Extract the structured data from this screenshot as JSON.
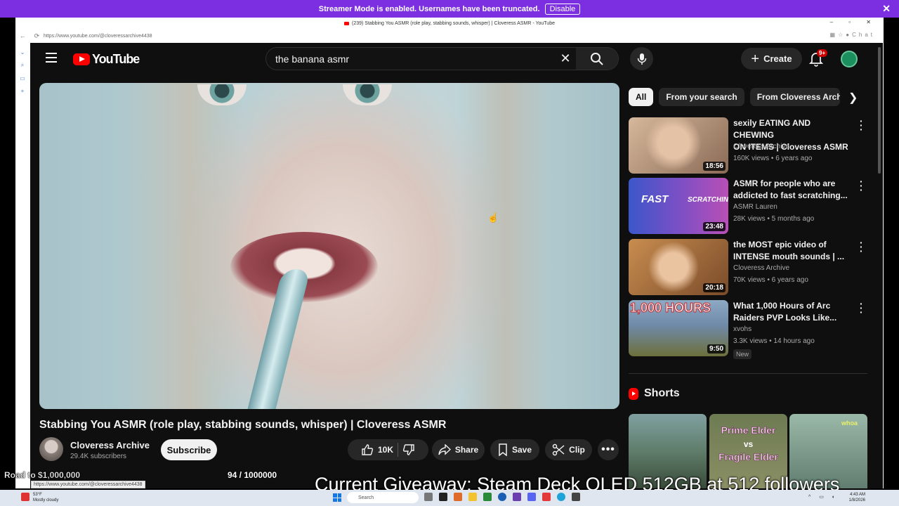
{
  "banner": {
    "message": "Streamer Mode is enabled. Usernames have been truncated.",
    "disable_label": "Disable",
    "close": "✕"
  },
  "browser": {
    "tab_title": "(239) Stabbing You ASMR (role play, stabbing sounds, whisper) | Cloveress ASMR - YouTube",
    "url": "https://www.youtube.com/@cloveressarchive4438",
    "chat_label": "Chat",
    "window_controls": "– ▫ ✕"
  },
  "masthead": {
    "logo_text": "YouTube",
    "search_query": "the banana asmr",
    "create_label": "Create",
    "notif_badge": "9+"
  },
  "video": {
    "title": "Stabbing You ASMR (role play, stabbing sounds, whisper) | Cloveress ASMR",
    "channel": "Cloveress Archive",
    "subscribers": "29.4K subscribers",
    "subscribe_label": "Subscribe",
    "likes": "10K",
    "share_label": "Share",
    "save_label": "Save",
    "clip_label": "Clip"
  },
  "chips": [
    "All",
    "From your search",
    "From Cloveress Archive"
  ],
  "recommendations": [
    {
      "title_l1": "sexily EATING AND CHEWING",
      "title_l2": "ON ITEMS | Cloveress ASMR",
      "channel": "Cloveress Archive",
      "meta": "160K views • 6 years ago",
      "duration": "18:56",
      "colors": [
        "#d6b89c",
        "#8a6a55"
      ]
    },
    {
      "title_l1": "ASMR for people who are",
      "title_l2": "addicted to fast scratching...",
      "channel": "ASMR Lauren",
      "meta": "28K views • 5 months ago",
      "duration": "23:48",
      "overlay_a": "FAST",
      "overlay_b": "SCRATCHING",
      "colors": [
        "#3b57c9",
        "#b84fb6"
      ]
    },
    {
      "title_l1": "the MOST epic video of",
      "title_l2": "INTENSE mouth sounds | ...",
      "channel": "Cloveress Archive",
      "meta": "70K views • 6 years ago",
      "duration": "20:18",
      "colors": [
        "#c88d4f",
        "#7a4b2a"
      ]
    },
    {
      "title_l1": "What 1,000 Hours of Arc",
      "title_l2": "Raiders PVP Looks Like...",
      "channel": "xvohs",
      "meta": "3.3K views • 14 hours ago",
      "duration": "9:50",
      "badge": "New",
      "overlay_a": "1,000 HOURS",
      "colors": [
        "#6f8aa8",
        "#6d6f3a"
      ]
    }
  ],
  "shorts": {
    "heading": "Shorts",
    "items": [
      {
        "text": "",
        "colors": [
          "#5f7d6a",
          "#3a4b3a"
        ]
      },
      {
        "text_l1": "Prime Elder",
        "text_mid": "vs",
        "text_l2": "Fragile Elder",
        "colors": [
          "#6d7b52",
          "#8b8f65"
        ]
      },
      {
        "text": "whoa",
        "colors": [
          "#9bb9a8",
          "#607d70"
        ]
      }
    ]
  },
  "overlays": {
    "road": "Road to $1,000,000",
    "counter": "94 / 1000000",
    "giveaway": "Current Giveaway: Steam Deck OLED 512GB at 512 followers",
    "url_hint": "https://www.youtube.com/@cloveressarchive4438"
  },
  "taskbar": {
    "weather_temp": "53°F",
    "weather_desc": "Mostly cloudy",
    "search_placeholder": "Search",
    "time": "4:43 AM",
    "date": "1/8/2026"
  }
}
